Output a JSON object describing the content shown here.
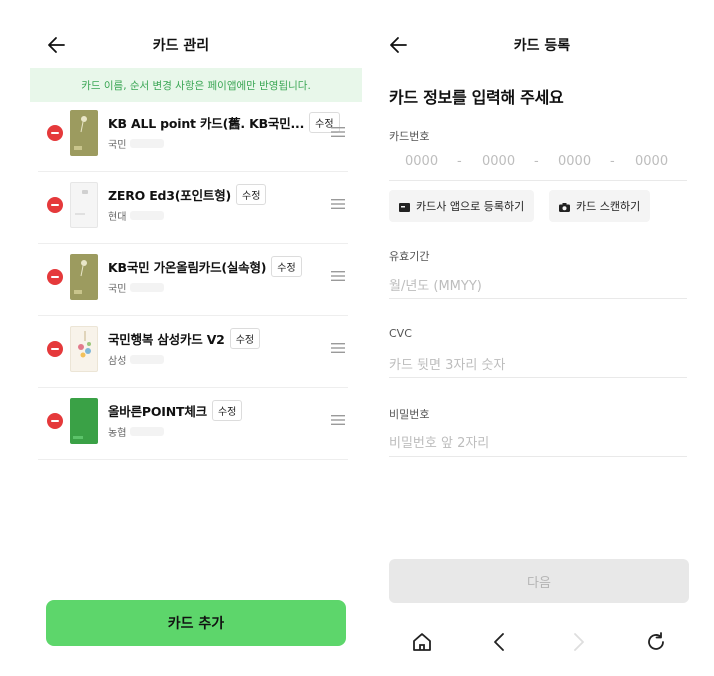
{
  "left": {
    "title": "카드 관리",
    "notice": "카드 이름, 순서 변경 사항은 페이앱에만 반영됩니다.",
    "edit_label": "수정",
    "cards": [
      {
        "name": "KB ALL point 카드(舊. KB국민...",
        "issuer": "국민",
        "thumb": "olive"
      },
      {
        "name": "ZERO Ed3(포인트형)",
        "issuer": "현대",
        "thumb": "white"
      },
      {
        "name": "KB국민 가온올림카드(실속형)",
        "issuer": "국민",
        "thumb": "olive"
      },
      {
        "name": "국민행복 삼성카드 V2",
        "issuer": "삼성",
        "thumb": "floral"
      },
      {
        "name": "올바른POINT체크",
        "issuer": "농협",
        "thumb": "green"
      }
    ],
    "add_button": "카드 추가",
    "colors": {
      "delete": "#e5393b",
      "add_button": "#5dd66b",
      "notice_bg": "#e8f7ea",
      "notice_text": "#3aa654"
    }
  },
  "right": {
    "title": "카드 등록",
    "heading": "카드 정보를 입력해 주세요",
    "card_number": {
      "label": "카드번호",
      "segments": [
        "0000",
        "0000",
        "0000",
        "0000"
      ],
      "separator": "-"
    },
    "app_register": "카드사 앱으로 등록하기",
    "scan_card": "카드 스캔하기",
    "expiry": {
      "label": "유효기간",
      "placeholder": "월/년도 (MMYY)"
    },
    "cvc": {
      "label": "CVC",
      "placeholder": "카드 뒷면 3자리 숫자"
    },
    "password": {
      "label": "비밀번호",
      "placeholder": "비밀번호 앞 2자리"
    },
    "next_button": "다음",
    "nav_icons": [
      "home-icon",
      "back-icon",
      "forward-icon",
      "refresh-icon"
    ]
  }
}
